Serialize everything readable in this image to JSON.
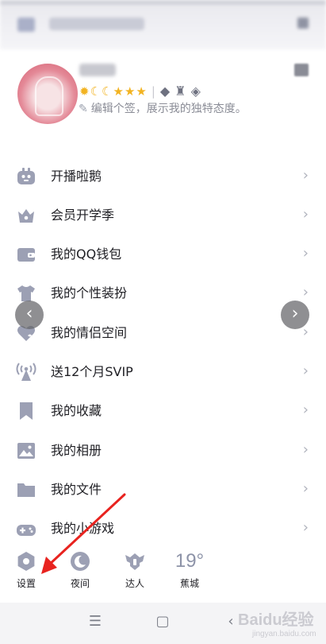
{
  "profile": {
    "signature": "编辑个签，展示我的独特态度。"
  },
  "menu": {
    "items": [
      {
        "label": "开播啦鹅",
        "icon": "penguin-tv-icon"
      },
      {
        "label": "会员开学季",
        "icon": "crown-icon"
      },
      {
        "label": "我的QQ钱包",
        "icon": "wallet-icon"
      },
      {
        "label": "我的个性装扮",
        "icon": "tshirt-icon"
      },
      {
        "label": "我的情侣空间",
        "icon": "heart-icon"
      },
      {
        "label": "送12个月SVIP",
        "icon": "broadcast-tower-icon"
      },
      {
        "label": "我的收藏",
        "icon": "bookmark-icon"
      },
      {
        "label": "我的相册",
        "icon": "photo-icon"
      },
      {
        "label": "我的文件",
        "icon": "folder-icon"
      },
      {
        "label": "我的小游戏",
        "icon": "gamepad-icon"
      }
    ],
    "chevron": "›"
  },
  "bottom_bar": {
    "settings_label": "设置",
    "night_label": "夜间",
    "talent_label": "达人",
    "weather_temp": "19°",
    "weather_city": "蕉城"
  },
  "nav": {
    "prev_arrow": "‹",
    "next_arrow": "›"
  },
  "system_nav": {
    "menu_glyph": "☰",
    "home_glyph": "▢",
    "back_glyph": "‹"
  },
  "watermark": {
    "text": "Baidu经验",
    "url": "jingyan.baidu.com"
  },
  "colors": {
    "icon_color": "#9ca0b4",
    "badge_gold": "#f2b321",
    "arrow_red": "#e8231f"
  }
}
